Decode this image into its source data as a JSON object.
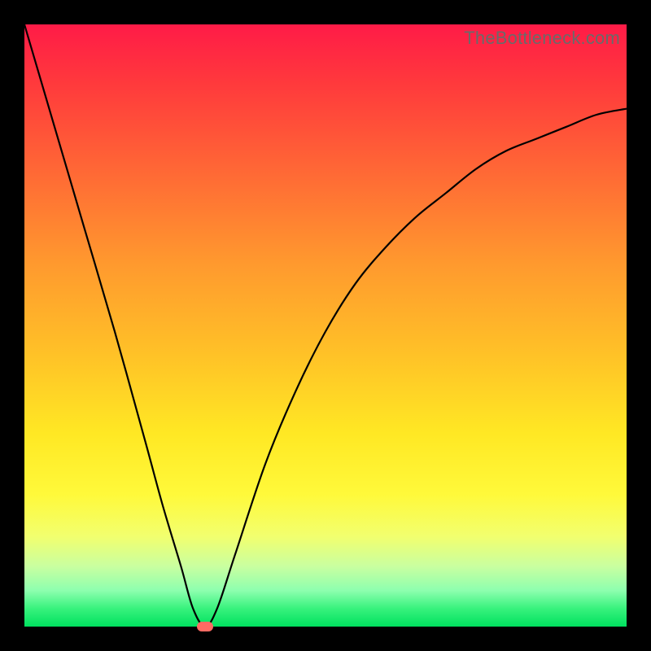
{
  "watermark": "TheBottleneck.com",
  "colors": {
    "frame": "#000000",
    "curve": "#000000",
    "marker": "#ff6b63",
    "gradient_stops": [
      "#ff1b47",
      "#ff3a3c",
      "#ff6a35",
      "#ff9a2e",
      "#ffc227",
      "#ffe824",
      "#fff93a",
      "#f2ff6e",
      "#c9ffa0",
      "#8dffaf",
      "#38f27d",
      "#00e15f"
    ]
  },
  "chart_data": {
    "type": "line",
    "title": "",
    "xlabel": "",
    "ylabel": "",
    "xlim": [
      0,
      100
    ],
    "ylim": [
      0,
      100
    ],
    "grid": false,
    "legend": false,
    "annotations": [
      "TheBottleneck.com"
    ],
    "series": [
      {
        "name": "bottleneck-curve",
        "x": [
          0,
          5,
          10,
          15,
          20,
          23,
          26,
          28,
          30,
          32,
          35,
          40,
          45,
          50,
          55,
          60,
          65,
          70,
          75,
          80,
          85,
          90,
          95,
          100
        ],
        "y": [
          100,
          83,
          66,
          49,
          31,
          20,
          10,
          3,
          0,
          3,
          12,
          27,
          39,
          49,
          57,
          63,
          68,
          72,
          76,
          79,
          81,
          83,
          85,
          86
        ]
      }
    ],
    "marker": {
      "x": 30,
      "y": 0
    }
  }
}
